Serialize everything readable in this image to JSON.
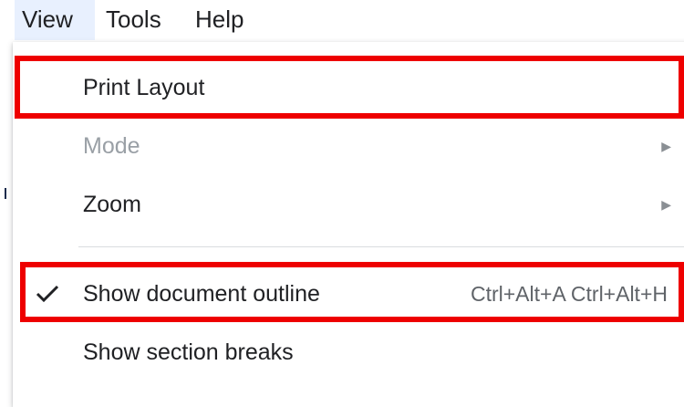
{
  "menubar": {
    "items": [
      {
        "label": "View"
      },
      {
        "label": "Tools"
      },
      {
        "label": "Help"
      }
    ]
  },
  "view_menu": {
    "items": [
      {
        "label": "Print Layout"
      },
      {
        "label": "Mode",
        "disabled": true,
        "submenu_icon": "submenu-arrow-icon"
      },
      {
        "label": "Zoom",
        "submenu_icon": "submenu-arrow-icon"
      },
      {
        "label": "Show document outline",
        "checked": true,
        "shortcut": "Ctrl+Alt+A Ctrl+Alt+H"
      },
      {
        "label": "Show section breaks"
      }
    ]
  },
  "icons": {
    "check": "check-icon",
    "submenu": "submenu-arrow-icon"
  },
  "colors": {
    "highlight_box": "#ee0000",
    "active_menu_bg": "#e8f0fe",
    "disabled_text": "#9aa0a6",
    "shortcut_text": "#5f6368"
  }
}
